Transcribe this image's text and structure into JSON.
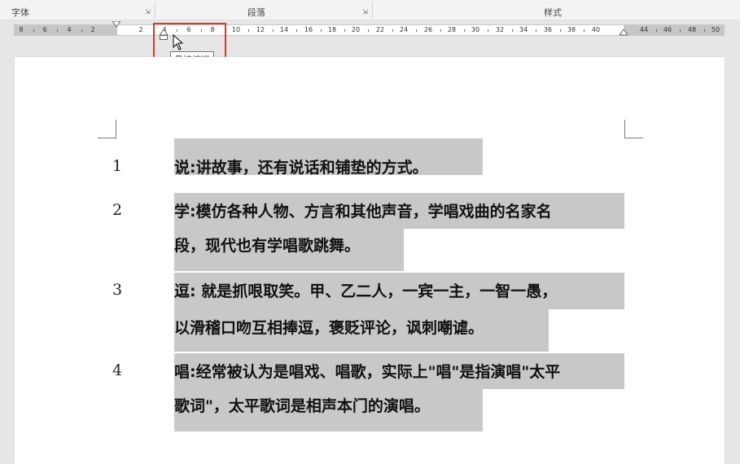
{
  "ribbon": {
    "groups": [
      {
        "label": "字体"
      },
      {
        "label": "段落"
      },
      {
        "label": "样式"
      }
    ]
  },
  "ruler": {
    "left_numbers": [
      "8",
      "6",
      "4",
      "2",
      "2",
      "4",
      "6",
      "8"
    ],
    "right_numbers": [
      "10",
      "12",
      "14",
      "16",
      "18",
      "20",
      "22",
      "24",
      "26",
      "28",
      "30",
      "32",
      "34",
      "36",
      "38",
      "40",
      "44",
      "46",
      "48",
      "50"
    ]
  },
  "tooltip": {
    "text": "悬挂缩进"
  },
  "document": {
    "items": [
      {
        "number": "1",
        "lines": [
          "说:讲故事，还有说话和铺垫的方式。"
        ]
      },
      {
        "number": "2",
        "lines": [
          "学:模仿各种人物、方言和其他声音，学唱戏曲的名家名",
          "段，现代也有学唱歌跳舞。"
        ]
      },
      {
        "number": "3",
        "lines": [
          "逗: 就是抓哏取笑。甲、乙二人，一宾一主，一智一愚，",
          "以滑稽口吻互相捧逗，褒贬评论，讽刺嘲谑。"
        ]
      },
      {
        "number": "4",
        "lines": [
          "唱:经常被认为是唱戏、唱歌，实际上\"唱\"是指演唱\"太平",
          "歌词\"，太平歌词是相声本门的演唱。"
        ]
      }
    ]
  }
}
